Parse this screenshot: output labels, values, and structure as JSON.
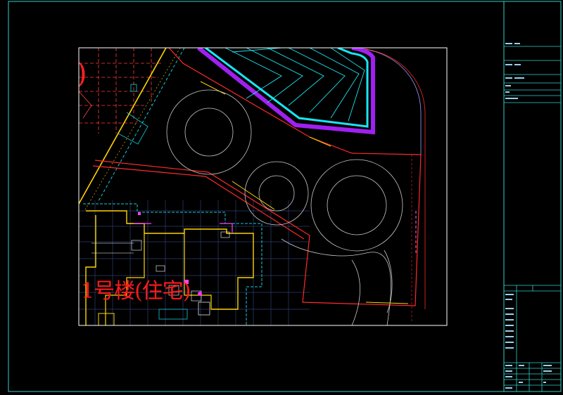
{
  "drawing": {
    "building_label": "1号楼(住宅)",
    "room_tags": [
      "",
      "",
      "",
      ""
    ],
    "colors": {
      "background": "#000000",
      "frame": "#2fd0c8",
      "viewport": "#ffffff",
      "boundary": "#ff2a2a",
      "road": "#ff3b3b",
      "walkway": "#18e6f0",
      "hedge": "#a020f0",
      "building": "#ffd400",
      "circles": "#c8c8c8",
      "grid": "#2e3e6e"
    }
  },
  "title_block": {
    "top_rows": [
      "",
      "",
      "",
      "",
      "",
      ""
    ],
    "side_notes": [
      "",
      "",
      "",
      "",
      "",
      "",
      "",
      ""
    ],
    "bottom_rows": [
      "",
      "",
      "",
      "",
      "",
      ""
    ]
  }
}
